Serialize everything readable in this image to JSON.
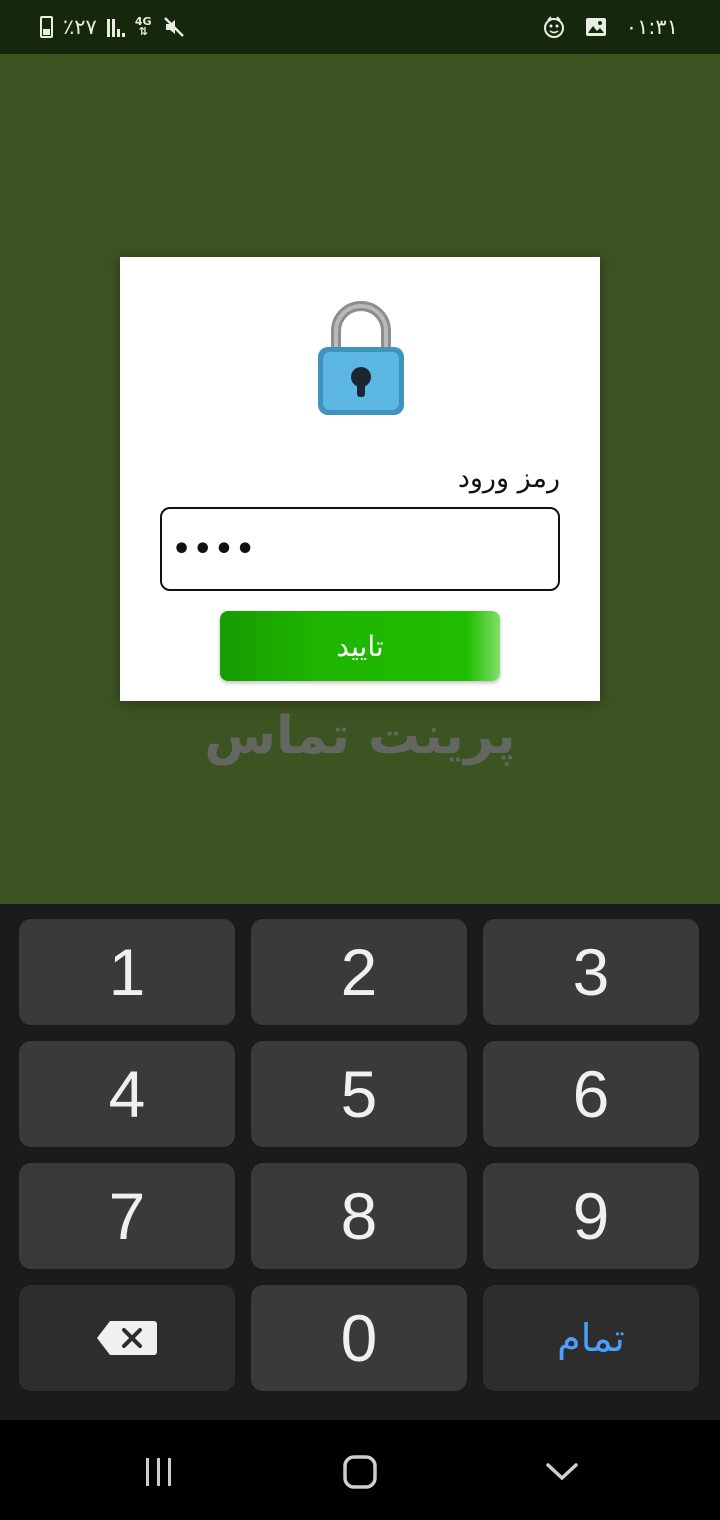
{
  "status_bar": {
    "battery_text": "٪۲۷",
    "network": "4G",
    "time": "۰۱:۳۱"
  },
  "dialog": {
    "password_label": "رمز ورود",
    "password_value": "••••",
    "confirm_label": "تایید"
  },
  "brand": {
    "title": "پرینت تماس"
  },
  "keyboard": {
    "keys": [
      "1",
      "2",
      "3",
      "4",
      "5",
      "6",
      "7",
      "8",
      "9",
      "0"
    ],
    "done_label": "تمام"
  },
  "colors": {
    "background": "#3c5322",
    "status_bar": "#15280e",
    "confirm_button": "#1fb500",
    "done_accent": "#4aa0ff"
  }
}
